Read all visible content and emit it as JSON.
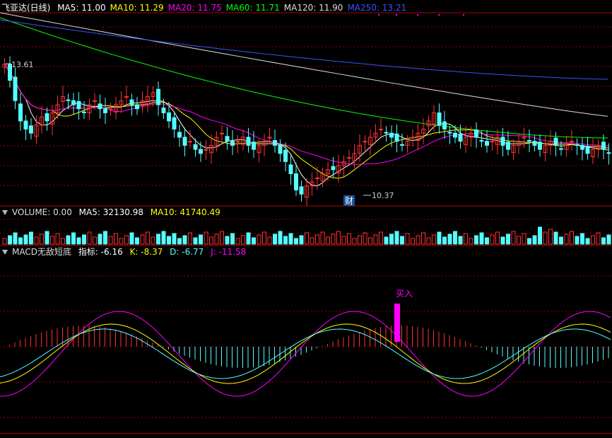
{
  "main_panel": {
    "stock_name": "飞亚达(日线)",
    "indicators": [
      {
        "label": "MA5: 11.00",
        "color": "#ffffff"
      },
      {
        "label": "MA10: 11.29",
        "color": "#ffff00"
      },
      {
        "label": "MA20: 11.75",
        "color": "#ff00ff"
      },
      {
        "label": "MA60: 11.71",
        "color": "#00ff00"
      },
      {
        "label": "MA120: 11.90",
        "color": "#dddddd"
      },
      {
        "label": "MA250: 13.21",
        "color": "#3355ff"
      }
    ],
    "high_label": "13.61",
    "low_label": "10.37",
    "event_marker": "财"
  },
  "volume_panel": {
    "title": "VOLUME: 0.00",
    "ma5": "MA5: 32130.98",
    "ma10": "MA10: 41740.49"
  },
  "macd_panel": {
    "title": "MACD无敌短底",
    "index": "指标: -6.16",
    "k": "K: -8.37",
    "d": "D: -6.77",
    "j": "J: -11.58",
    "buy_label": "买入"
  },
  "colors": {
    "up": "#ff3232",
    "down": "#54ffff",
    "grid": "#8b0000",
    "ma5": "#ffffff",
    "ma10": "#ffff00",
    "ma20": "#ff00ff",
    "ma60": "#00ff00",
    "ma120": "#dddddd",
    "ma250": "#3355ff"
  }
}
